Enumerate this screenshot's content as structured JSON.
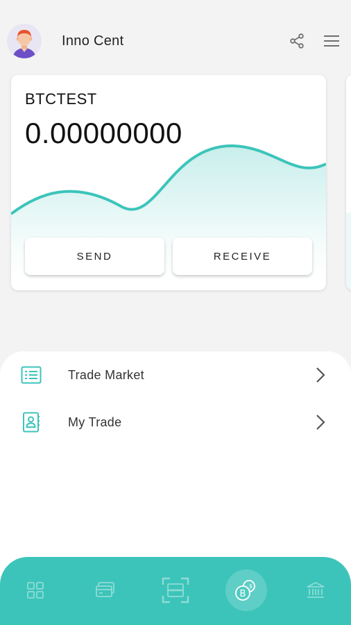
{
  "header": {
    "user_name": "Inno Cent",
    "avatar_icon": "user-avatar",
    "share_icon": "share-icon",
    "menu_icon": "hamburger-menu-icon"
  },
  "wallet_card": {
    "coin_name": "BTCTEST",
    "balance": "0.00000000",
    "send_label": "SEND",
    "receive_label": "RECEIVE",
    "accent_color": "#3cc4ba"
  },
  "menu": {
    "items": [
      {
        "label": "Trade Market",
        "icon": "list-icon"
      },
      {
        "label": "My Trade",
        "icon": "contact-book-icon"
      }
    ]
  },
  "bottom_nav": {
    "items": [
      {
        "icon": "dashboard-icon",
        "active": false
      },
      {
        "icon": "card-icon",
        "active": false
      },
      {
        "icon": "scan-icon",
        "active": false
      },
      {
        "icon": "crypto-exchange-icon",
        "active": true
      },
      {
        "icon": "bank-icon",
        "active": false
      }
    ],
    "background": "#3cc4ba"
  }
}
